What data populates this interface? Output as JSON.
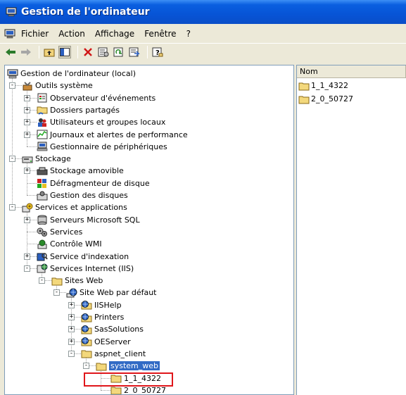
{
  "window": {
    "title": "Gestion de l'ordinateur"
  },
  "menu": [
    "Fichier",
    "Action",
    "Affichage",
    "Fenêtre",
    "?"
  ],
  "toolbar_icons": [
    "back-arrow-icon",
    "forward-arrow-icon",
    "up-folder-icon",
    "show-hide-tree-icon",
    "delete-icon",
    "properties-icon",
    "refresh-icon",
    "export-list-icon",
    "help-icon"
  ],
  "tree": [
    {
      "label": "Gestion de l'ordinateur (local)",
      "icon": "computer-icon",
      "level": 0,
      "expander": ""
    },
    {
      "label": "Outils système",
      "icon": "tools-icon",
      "level": 1,
      "expander": "−"
    },
    {
      "label": "Observateur d'événements",
      "icon": "event-viewer-icon",
      "level": 2,
      "expander": "+"
    },
    {
      "label": "Dossiers partagés",
      "icon": "shared-folders-icon",
      "level": 2,
      "expander": "+"
    },
    {
      "label": "Utilisateurs et groupes locaux",
      "icon": "users-icon",
      "level": 2,
      "expander": "+"
    },
    {
      "label": "Journaux et alertes de performance",
      "icon": "performance-icon",
      "level": 2,
      "expander": "+"
    },
    {
      "label": "Gestionnaire de périphériques",
      "icon": "device-manager-icon",
      "level": 2,
      "expander": ""
    },
    {
      "label": "Stockage",
      "icon": "storage-icon",
      "level": 1,
      "expander": "−"
    },
    {
      "label": "Stockage amovible",
      "icon": "removable-storage-icon",
      "level": 2,
      "expander": "+"
    },
    {
      "label": "Défragmenteur de disque",
      "icon": "defrag-icon",
      "level": 2,
      "expander": ""
    },
    {
      "label": "Gestion des disques",
      "icon": "disk-management-icon",
      "level": 2,
      "expander": ""
    },
    {
      "label": "Services et applications",
      "icon": "services-apps-icon",
      "level": 1,
      "expander": "−"
    },
    {
      "label": "Serveurs Microsoft SQL",
      "icon": "sql-server-icon",
      "level": 2,
      "expander": "+"
    },
    {
      "label": "Services",
      "icon": "services-icon",
      "level": 2,
      "expander": ""
    },
    {
      "label": "Contrôle WMI",
      "icon": "wmi-icon",
      "level": 2,
      "expander": ""
    },
    {
      "label": "Service d'indexation",
      "icon": "indexing-icon",
      "level": 2,
      "expander": "+"
    },
    {
      "label": "Services Internet (IIS)",
      "icon": "iis-icon",
      "level": 2,
      "expander": "−"
    },
    {
      "label": "Sites Web",
      "icon": "folder-icon",
      "level": 3,
      "expander": "−"
    },
    {
      "label": "Site Web par défaut",
      "icon": "website-icon",
      "level": 4,
      "expander": "−"
    },
    {
      "label": "IISHelp",
      "icon": "web-folder-icon",
      "level": 5,
      "expander": "+"
    },
    {
      "label": "Printers",
      "icon": "web-folder-icon",
      "level": 5,
      "expander": "+"
    },
    {
      "label": "SasSolutions",
      "icon": "web-folder-icon",
      "level": 5,
      "expander": "+"
    },
    {
      "label": "OEServer",
      "icon": "web-folder-icon",
      "level": 5,
      "expander": "+"
    },
    {
      "label": "aspnet_client",
      "icon": "folder-icon",
      "level": 5,
      "expander": "−"
    },
    {
      "label": "system_web",
      "icon": "folder-icon",
      "level": 6,
      "expander": "−",
      "selected": true
    },
    {
      "label": "1_1_4322",
      "icon": "folder-icon",
      "level": 7,
      "expander": ""
    },
    {
      "label": "2_0_50727",
      "icon": "folder-icon",
      "level": 7,
      "expander": ""
    }
  ],
  "list": {
    "column_header": "Nom",
    "items": [
      {
        "label": "1_1_4322",
        "icon": "folder-icon"
      },
      {
        "label": "2_0_50727",
        "icon": "folder-icon"
      }
    ]
  }
}
